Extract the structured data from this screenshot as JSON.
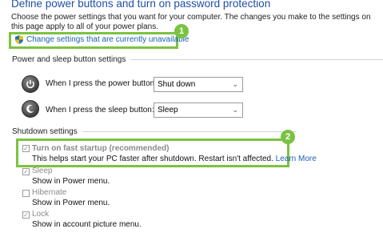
{
  "header": {
    "title": "Define power buttons and turn on password protection",
    "intro": "Choose the power settings that you want for your computer. The changes you make to the settings on this page apply to all of your power plans."
  },
  "uac_link": {
    "label": "Change settings that are currently unavailable",
    "icon": "uac-shield-icon",
    "callout": "1"
  },
  "power_sleep": {
    "heading": "Power and sleep button settings",
    "power_button": {
      "label": "When I press the power button:",
      "value": "Shut down",
      "icon": "power-icon"
    },
    "sleep_button": {
      "label": "When I press the sleep button:",
      "value": "Sleep",
      "icon": "moon-icon"
    }
  },
  "shutdown": {
    "heading": "Shutdown settings",
    "callout": "2",
    "fast_startup": {
      "label": "Turn on fast startup (recommended)",
      "desc": "This helps start your PC faster after shutdown. Restart isn't affected.",
      "learn_more": "Learn More",
      "checked": true
    },
    "sleep": {
      "label": "Sleep",
      "desc": "Show in Power menu.",
      "checked": true
    },
    "hibernate": {
      "label": "Hibernate",
      "desc": "Show in Power menu.",
      "checked": false
    },
    "lock": {
      "label": "Lock",
      "desc": "Show in account picture menu.",
      "checked": true
    }
  },
  "colors": {
    "accent_link": "#1a5fb4",
    "title": "#1e4fa3",
    "callout": "#7cc242"
  }
}
